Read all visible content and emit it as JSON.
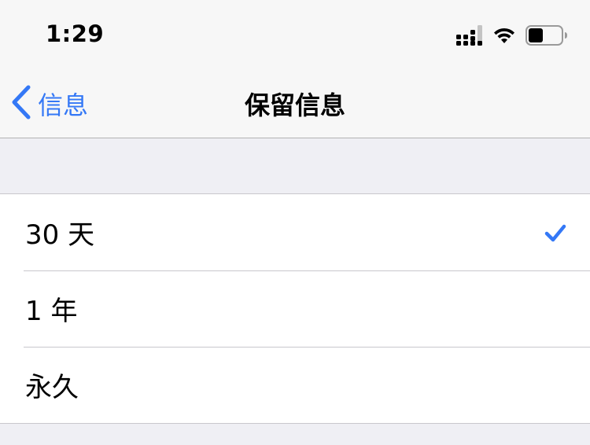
{
  "status_bar": {
    "time": "1:29",
    "icons": [
      "cellular-signal-icon",
      "wifi-icon",
      "battery-icon"
    ],
    "battery_level": 0.45
  },
  "nav": {
    "back_label": "信息",
    "title": "保留信息"
  },
  "options": [
    {
      "label": "30 天",
      "selected": true
    },
    {
      "label": "1 年",
      "selected": false
    },
    {
      "label": "永久",
      "selected": false
    }
  ],
  "colors": {
    "accent": "#3478f6",
    "background": "#efeff4",
    "separator": "#c8c7cc"
  }
}
